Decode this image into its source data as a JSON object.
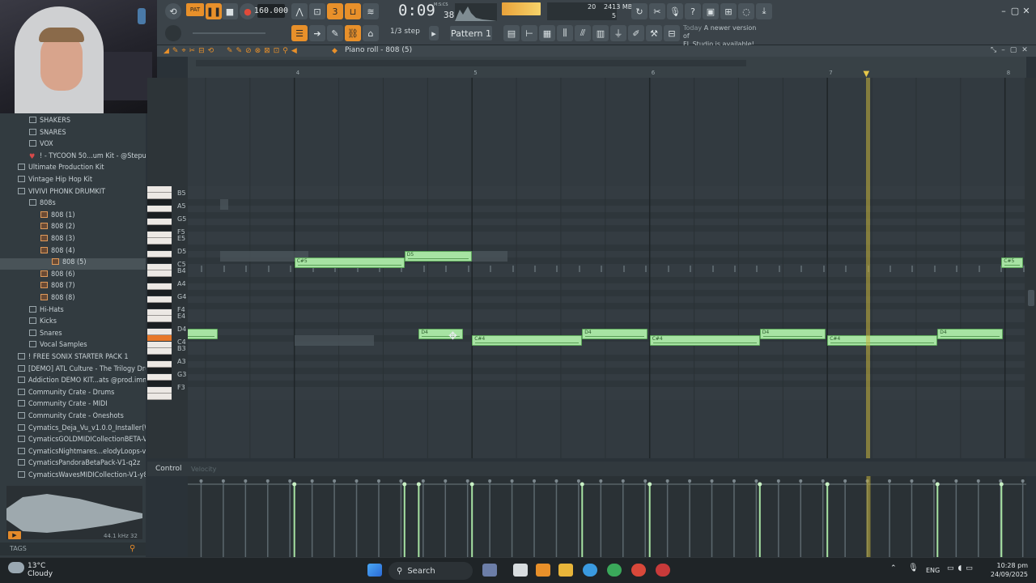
{
  "toolbar": {
    "pat_label": "PAT",
    "tempo": "160.000",
    "time_main": "0:09",
    "time_sub": "38",
    "time_unit": "M:S:CS",
    "cpu_value": "20",
    "mem_value": "2413 MB",
    "mem_sub": "5",
    "step_label": "1/3 step",
    "pattern_label": "Pattern 1",
    "news_today": "Today",
    "news_text_1": "A newer version of",
    "news_text_2": "FL Studio is available!"
  },
  "browser": {
    "items": [
      {
        "label": "SHAKERS",
        "indent": 1,
        "icon": "folder"
      },
      {
        "label": "SNARES",
        "indent": 1,
        "icon": "folder"
      },
      {
        "label": "VOX",
        "indent": 1,
        "icon": "folder"
      },
      {
        "label": "! - TYCOON 50...um Kit - @Stepuz",
        "indent": 1,
        "icon": "heart"
      },
      {
        "label": "Ultimate Production Kit",
        "indent": 0,
        "icon": "folder"
      },
      {
        "label": "Vintage Hip Hop Kit",
        "indent": 0,
        "icon": "folder"
      },
      {
        "label": "VIVIVI PHONK DRUMKIT",
        "indent": 0,
        "icon": "folder"
      },
      {
        "label": "808s",
        "indent": 1,
        "icon": "folder"
      },
      {
        "label": "808 (1)",
        "indent": 2,
        "icon": "audio"
      },
      {
        "label": "808 (2)",
        "indent": 2,
        "icon": "audio"
      },
      {
        "label": "808 (3)",
        "indent": 2,
        "icon": "audio"
      },
      {
        "label": "808 (4)",
        "indent": 2,
        "icon": "audio"
      },
      {
        "label": "808 (5)",
        "indent": 3,
        "icon": "audio",
        "selected": true
      },
      {
        "label": "808 (6)",
        "indent": 2,
        "icon": "audio"
      },
      {
        "label": "808 (7)",
        "indent": 2,
        "icon": "audio"
      },
      {
        "label": "808 (8)",
        "indent": 2,
        "icon": "audio"
      },
      {
        "label": "Hi-Hats",
        "indent": 1,
        "icon": "folder"
      },
      {
        "label": "Kicks",
        "indent": 1,
        "icon": "folder"
      },
      {
        "label": "Snares",
        "indent": 1,
        "icon": "folder"
      },
      {
        "label": "Vocal Samples",
        "indent": 1,
        "icon": "folder"
      },
      {
        "label": "! FREE SONIX STARTER PACK 1",
        "indent": 0,
        "icon": "folder"
      },
      {
        "label": "[DEMO] ATL Culture - The Trilogy Drum Kit",
        "indent": 0,
        "icon": "folder"
      },
      {
        "label": "Addiction DEMO KIT...ats @prod.immortal]",
        "indent": 0,
        "icon": "folder"
      },
      {
        "label": "Community Crate - Drums",
        "indent": 0,
        "icon": "folder"
      },
      {
        "label": "Community Crate - MIDI",
        "indent": 0,
        "icon": "folder"
      },
      {
        "label": "Community Crate - Oneshots",
        "indent": 0,
        "icon": "folder"
      },
      {
        "label": "Cymatics_Deja_Vu_v1.0.0_Installer(WIN)",
        "indent": 0,
        "icon": "folder"
      },
      {
        "label": "CymaticsGOLDMIDICollectionBETA-V1-t8u",
        "indent": 0,
        "icon": "folder"
      },
      {
        "label": "CymaticsNightmares...elodyLoops-v1-o6b",
        "indent": 0,
        "icon": "folder"
      },
      {
        "label": "CymaticsPandoraBetaPack-V1-q2z",
        "indent": 0,
        "icon": "folder"
      },
      {
        "label": "CymaticsWavesMIDICollection-V1-y8u",
        "indent": 0,
        "icon": "folder"
      }
    ],
    "sample_rate": "44.1 kHz 32",
    "tags_label": "TAGS"
  },
  "piano_roll": {
    "title": "Piano roll - 808 (5)",
    "bar_numbers": [
      "4",
      "5",
      "6",
      "7",
      "8"
    ],
    "key_labels": [
      "B5",
      "A5",
      "G5",
      "F5",
      "E5",
      "D5",
      "C5",
      "B4",
      "A4",
      "G4",
      "F4",
      "E4",
      "D4",
      "C4",
      "B3",
      "A3",
      "G3",
      "F3"
    ],
    "notes": [
      {
        "label": "C#5",
        "start": 4.0,
        "len": 0.62,
        "row": "C#5"
      },
      {
        "label": "D5",
        "start": 4.62,
        "len": 0.38,
        "row": "D5"
      },
      {
        "label": "C#5",
        "start": 7.98,
        "len": 0.12,
        "row": "C#5"
      },
      {
        "label": "C#4",
        "start": 3.0,
        "len": 0.2,
        "row": "C#4"
      },
      {
        "label": "D4",
        "start": 3.2,
        "len": 0.37,
        "row": "D4"
      },
      {
        "label": "D4",
        "start": 4.7,
        "len": 0.25,
        "row": "D4"
      },
      {
        "label": "C#4",
        "start": 5.0,
        "len": 0.62,
        "row": "C#4"
      },
      {
        "label": "D4",
        "start": 5.62,
        "len": 0.37,
        "row": "D4"
      },
      {
        "label": "C#4",
        "start": 6.0,
        "len": 0.62,
        "row": "C#4"
      },
      {
        "label": "D4",
        "start": 6.62,
        "len": 0.37,
        "row": "D4"
      },
      {
        "label": "C#4",
        "start": 7.0,
        "len": 0.62,
        "row": "C#4"
      },
      {
        "label": "D4",
        "start": 7.62,
        "len": 0.37,
        "row": "D4"
      }
    ],
    "playhead_bar": 7.22,
    "control_label": "Control",
    "control_sub": "Velocity"
  },
  "taskbar": {
    "temperature": "13°C",
    "condition": "Cloudy",
    "search_label": "Search",
    "language": "ENG",
    "clock_time": "10:28 pm",
    "clock_date": "24/09/2025"
  },
  "colors": {
    "accent": "#e8902a",
    "note_fill": "#a7e3a3",
    "playhead": "#e7c84a"
  }
}
